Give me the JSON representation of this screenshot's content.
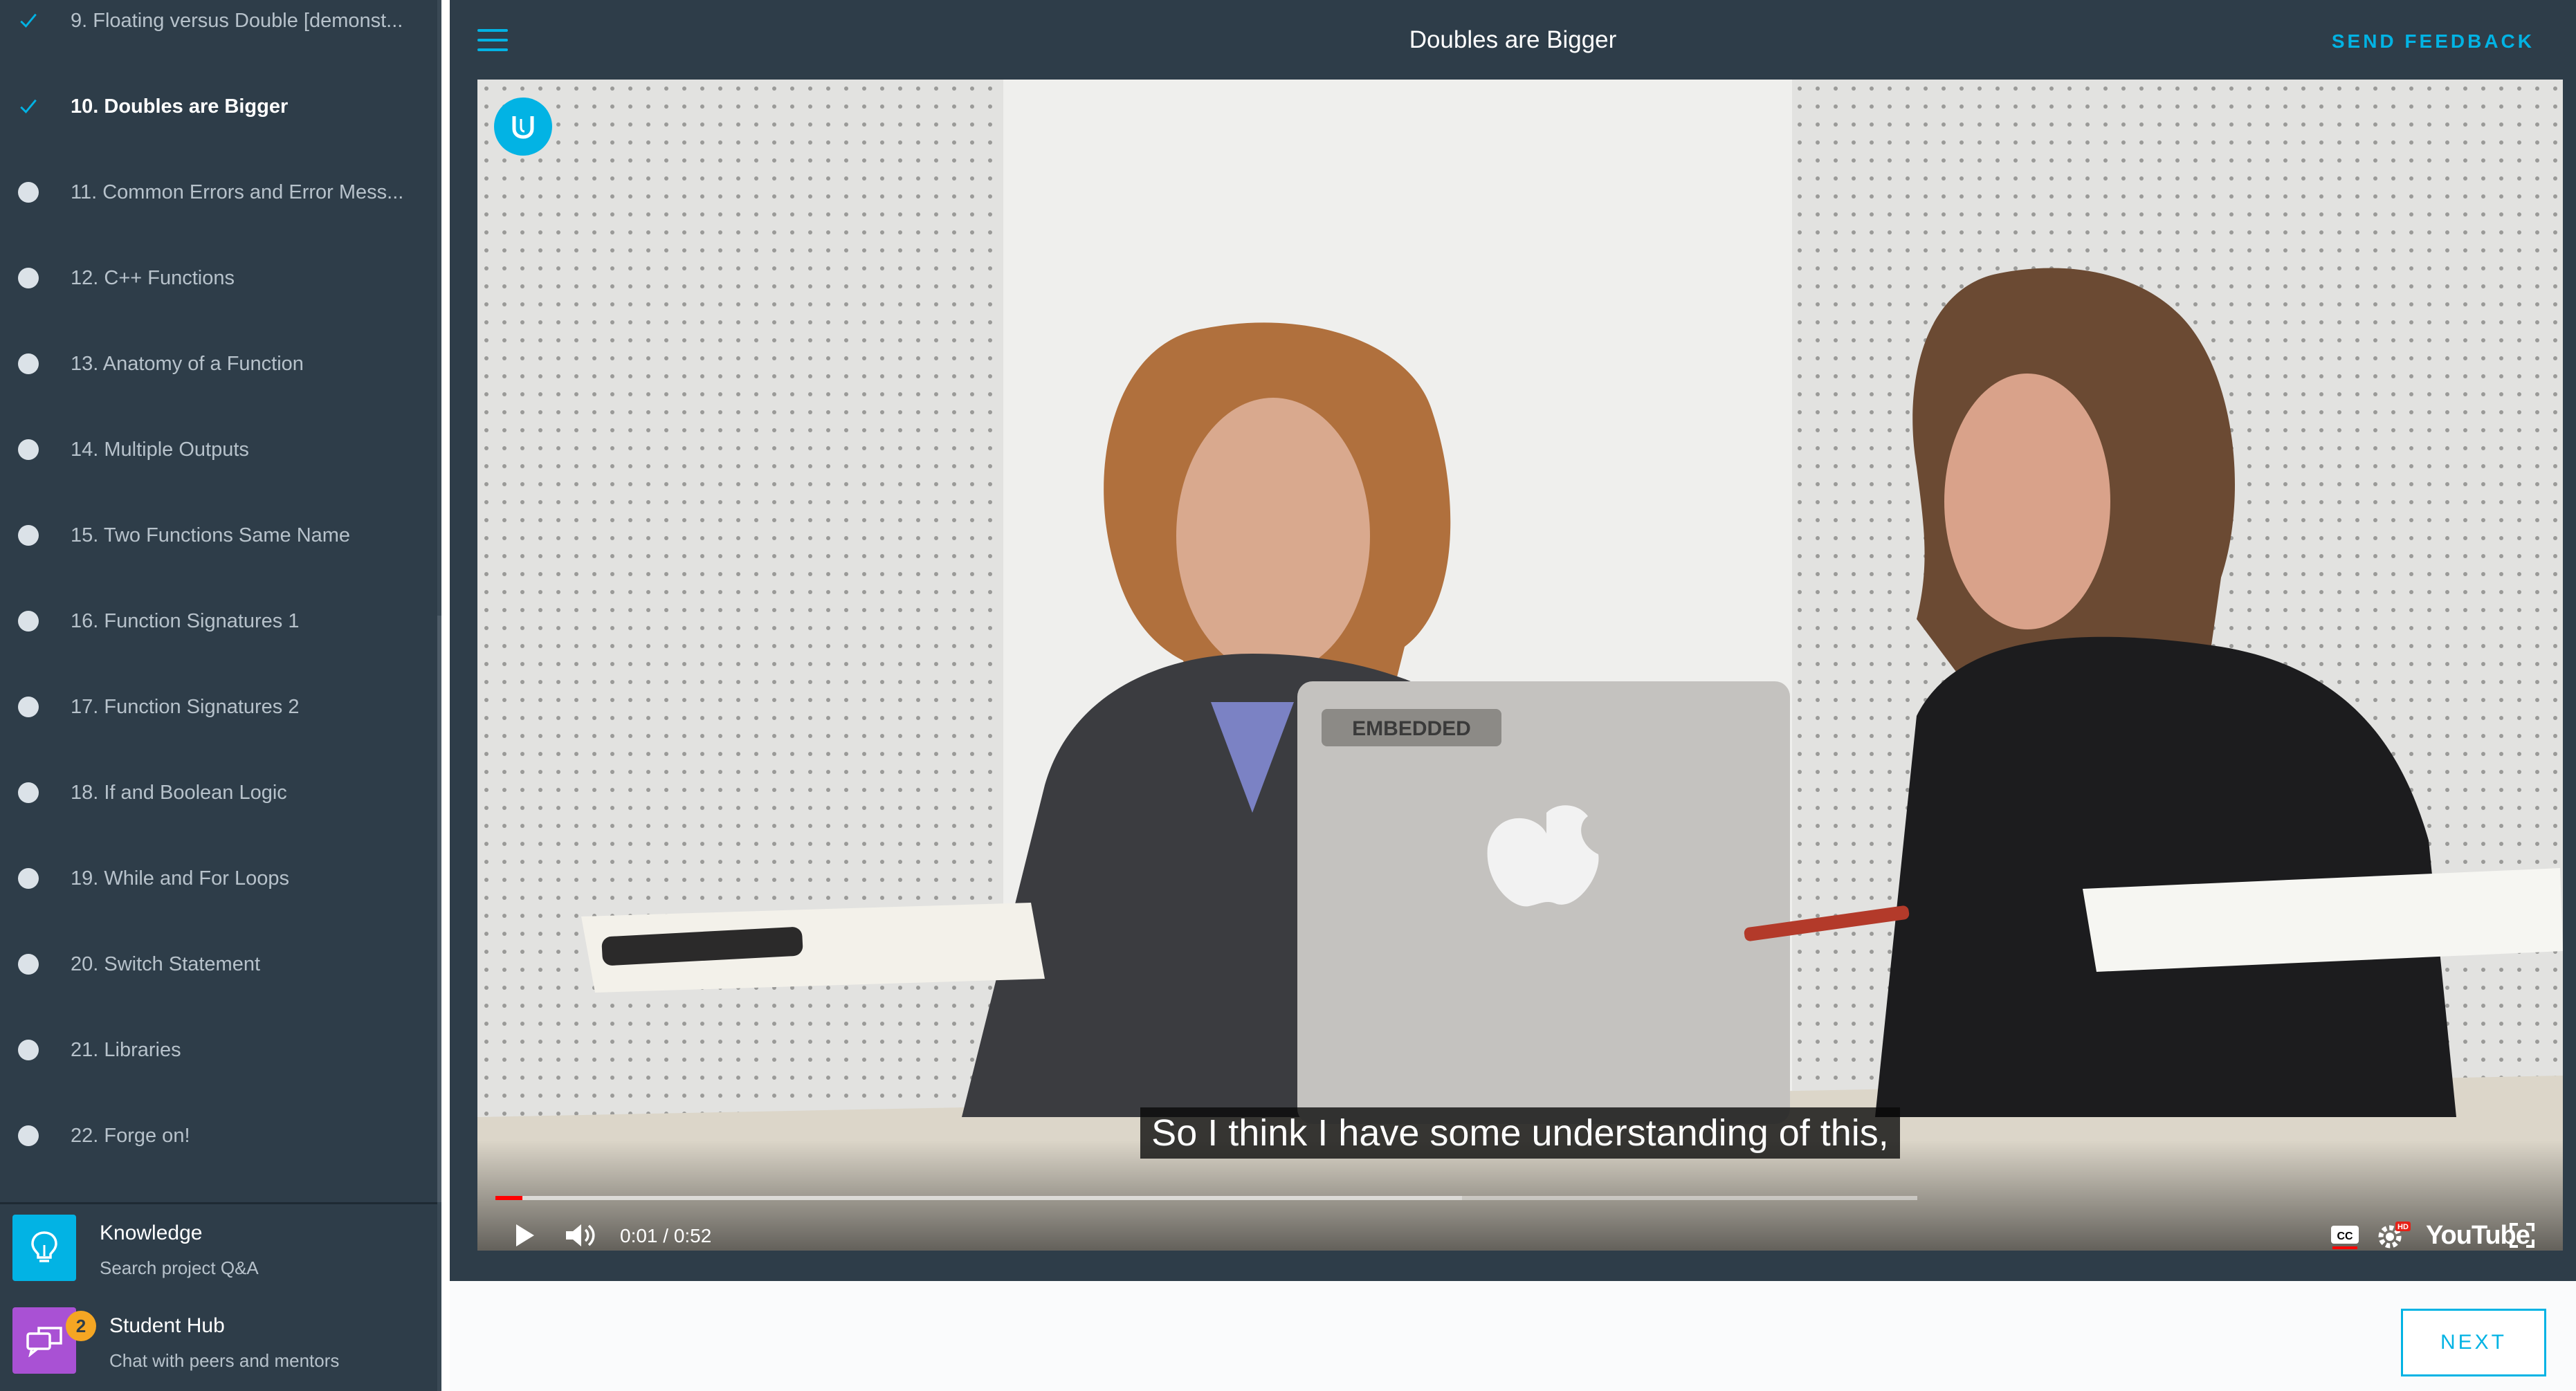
{
  "sidebar": {
    "lessons": [
      {
        "label": "9. Floating versus Double [demonst...",
        "status": "complete"
      },
      {
        "label": "10. Doubles are Bigger",
        "status": "complete",
        "active": true
      },
      {
        "label": "11. Common Errors and Error Mess...",
        "status": "incomplete"
      },
      {
        "label": "12. C++ Functions",
        "status": "incomplete"
      },
      {
        "label": "13. Anatomy of a Function",
        "status": "incomplete"
      },
      {
        "label": "14. Multiple Outputs",
        "status": "incomplete"
      },
      {
        "label": "15. Two Functions Same Name",
        "status": "incomplete"
      },
      {
        "label": "16. Function Signatures 1",
        "status": "incomplete"
      },
      {
        "label": "17. Function Signatures 2",
        "status": "incomplete"
      },
      {
        "label": "18. If and Boolean Logic",
        "status": "incomplete"
      },
      {
        "label": "19. While and For Loops",
        "status": "incomplete"
      },
      {
        "label": "20. Switch Statement",
        "status": "incomplete"
      },
      {
        "label": "21. Libraries",
        "status": "incomplete"
      },
      {
        "label": "22. Forge on!",
        "status": "incomplete"
      }
    ],
    "knowledge": {
      "title": "Knowledge",
      "subtitle": "Search project Q&A",
      "icon": "lightbulb-icon",
      "color": "#02b3e4"
    },
    "student_hub": {
      "title": "Student Hub",
      "subtitle": "Chat with peers and mentors",
      "icon": "chat-bubbles-icon",
      "color": "#a951d4",
      "badge": "2"
    }
  },
  "header": {
    "title": "Doubles are Bigger",
    "feedback": "SEND FEEDBACK",
    "menu_icon": "hamburger-menu-icon",
    "accent": "#02b3e4",
    "background": "#2e3d49"
  },
  "video": {
    "caption": "So I think I have some understanding of this,",
    "time": "0:01 / 0:52",
    "progress": 0.019,
    "buffered": 0.68,
    "laptop_sticker": "EMBEDDED",
    "youtube_label": "YouTube",
    "cc_label": "CC",
    "hd_label": "HD"
  },
  "footer": {
    "next_label": "NEXT"
  }
}
